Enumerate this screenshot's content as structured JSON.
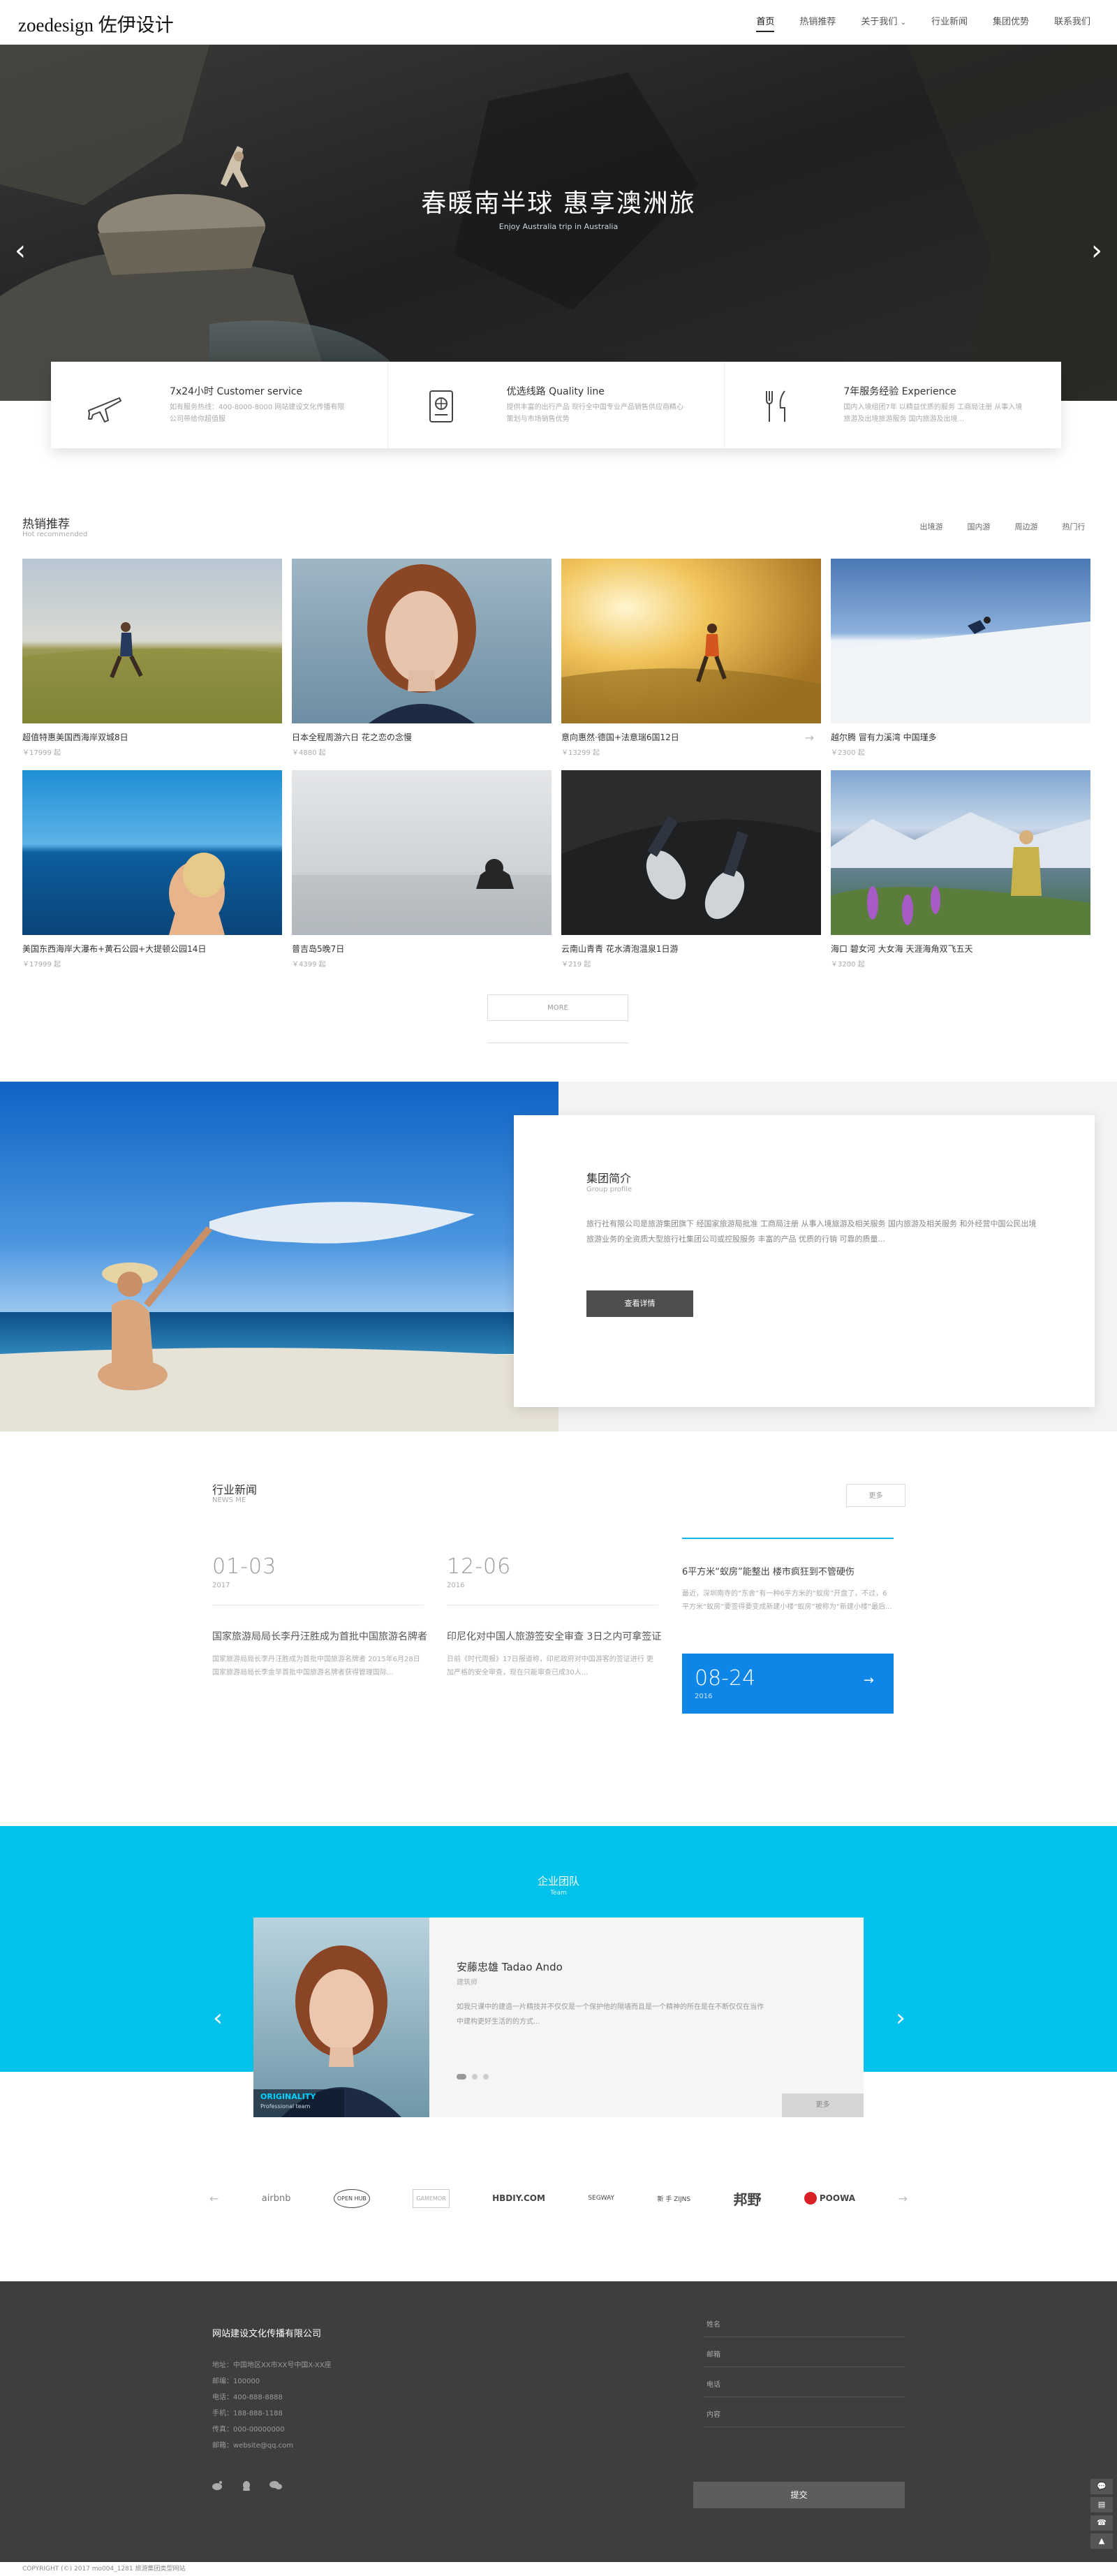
{
  "header": {
    "logo": "zoedesign 佐伊设计",
    "nav": [
      "首页",
      "热销推荐",
      "关于我们",
      "行业新闻",
      "集团优势",
      "联系我们"
    ],
    "nav_dropdown_caret": "⌄"
  },
  "hero": {
    "title": "春暖南半球 惠享澳洲旅",
    "subtitle": "Enjoy Australia trip in Australia",
    "prev": "‹",
    "next": "›"
  },
  "services": [
    {
      "icon": "airplane-icon",
      "title": "7x24小时 Customer service",
      "desc": "如有服务热线：400-8000-8000 网站建设文化传播有限公司带给你超值服"
    },
    {
      "icon": "passport-icon",
      "title": "优选线路 Quality line",
      "desc": "提供丰富的出行产品 现行全中国专业产品销售供应商精心策划与市场销售优势"
    },
    {
      "icon": "dining-icon",
      "title": "7年服务经验 Experience",
      "desc": "国内入境组团7年 以精益优质的服务 工商局注册 从事入境旅游及出境旅游服务 国内旅游及出境..."
    }
  ],
  "hot": {
    "title": "热销推荐",
    "subtitle": "Hot recommended",
    "tabs": [
      "出境游",
      "国内游",
      "周边游",
      "热门行"
    ],
    "cards": [
      {
        "name": "超值特惠美国西海岸双城8日",
        "price": "￥17999 起"
      },
      {
        "name": "日本全程周游六日 花之恋の念慢",
        "price": "￥4880 起"
      },
      {
        "name": "意向惠然·德国+法意瑞6国12日",
        "price": "￥13299 起"
      },
      {
        "name": "越尔腾 冒有力溪湾 中国瑾多",
        "price": "￥2300 起"
      },
      {
        "name": "美国东西海岸大瀑布+黄石公园+大提顿公园14日",
        "price": "￥17999 起"
      },
      {
        "name": "普吉岛5晚7日",
        "price": "￥4399 起"
      },
      {
        "name": "云南山青青 花水清泡温泉1日游",
        "price": "￥219 起"
      },
      {
        "name": "海口 碧女河 大女海 天涯海角双飞五天",
        "price": "￥3200 起"
      }
    ],
    "arrow": "→",
    "more": "MORE"
  },
  "group": {
    "title": "集团简介",
    "subtitle": "Group profile",
    "text": "旅行社有限公司是旅游集团旗下 经国家旅游局批准 工商局注册 从事入境旅游及相关服务 国内旅游及相关服务 和外经营中国公民出境旅游业务的全资质大型旅行社集团公司或控股服务 丰富的产品 优质的行销 可靠的质量...",
    "button": "查看详情"
  },
  "news": {
    "title": "行业新闻",
    "subtitle": "NEWS ME",
    "more": "更多",
    "items": [
      {
        "date": "01-03",
        "year": "2017",
        "head": "国家旅游局局长李丹汪胜成为首批中国旅游名牌者",
        "body": "国家旅游局局长李丹汪胜成为首批中国旅游名牌者 2015年6月28日 国家旅游局局长李金早首批中国旅游名牌者获得管理国际..."
      },
      {
        "date": "12-06",
        "year": "2016",
        "head": "印尼化对中国人旅游签安全审查 3日之内可拿签证",
        "body": "日前《时代周报》17日报道称，印尼政府对中国游客的签证进行 更加严格的安全审查，现在只能审查已成30人..."
      }
    ],
    "right": {
      "head": "6平方米“蚁房”能整出 楼市疯狂到不管硬伤",
      "body": "最近，深圳南寺的“东舍”有一种6平方米的“蚁房”开盘了，不过，6平方米“蚁房”要签得要变成新建小楼“蚁房”被称为“新建小楼”最后..."
    },
    "highlight": {
      "date": "08-24",
      "year": "2016",
      "arrow": "→"
    }
  },
  "team": {
    "title": "企业团队",
    "subtitle": "Team",
    "name": "安藤忠雄 Tadao Ando",
    "role": "建筑师",
    "desc": "如我只课中的建造一片精技并不仅仅是一个保护他的隔墙而且是一个精神的所在是在不断仅仅在当作中建构更好生活的的方式...",
    "badge": "ORIGINALITY",
    "badge_sub": "Professional team",
    "button": "更多",
    "prev": "‹",
    "next": "›"
  },
  "partners": {
    "prev": "←",
    "next": "→",
    "logos": [
      "airbnb",
      "OPEN HUB",
      "GAMEMOR",
      "HBDIY.COM",
      "SEGWAY",
      "新 手 ZIJNS",
      "邦野",
      "POOWA"
    ]
  },
  "footer": {
    "company": "网站建设文化传播有限公司",
    "lines": [
      "地址：中国地区XX市XX号中国X-XX座",
      "邮编：100000",
      "电话：400-888-8888",
      "手机：188-888-1188",
      "传真：000-00000000",
      "邮箱：website@qq.com"
    ],
    "form": [
      "姓名",
      "邮箱",
      "电话",
      "内容"
    ],
    "submit": "提交",
    "copyright": "COPYRIGHT (©) 2017 mo004_1281 旅游集团类型网站",
    "side_tools": [
      "💬",
      "▤",
      "☎",
      "▲"
    ]
  }
}
